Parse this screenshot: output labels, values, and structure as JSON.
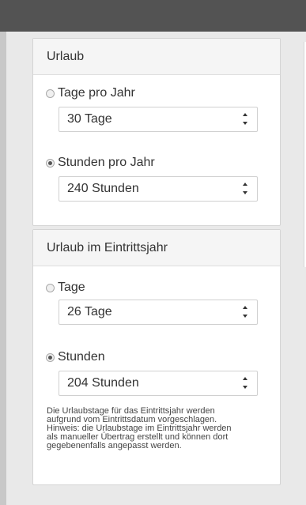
{
  "vacation": {
    "title": "Urlaub",
    "days_option": {
      "label": "Tage pro Jahr",
      "value": "30 Tage",
      "checked": false
    },
    "hours_option": {
      "label": "Stunden pro Jahr",
      "value": "240 Stunden",
      "checked": true
    }
  },
  "entry_year": {
    "title": "Urlaub im Eintrittsjahr",
    "days_option": {
      "label": "Tage",
      "value": "26 Tage",
      "checked": false
    },
    "hours_option": {
      "label": "Stunden",
      "value": "204 Stunden",
      "checked": true
    },
    "hint_lines": [
      "Die Urlaubstage für das Eintrittsjahr werden",
      "aufgrund vom Eintrittsdatum vorgeschlagen.",
      "Hinweis: die Urlaubstage im Eintrittsjahr werden",
      "als manueller Übertrag erstellt und können dort",
      "gegebenenfalls angepasst werden."
    ]
  }
}
